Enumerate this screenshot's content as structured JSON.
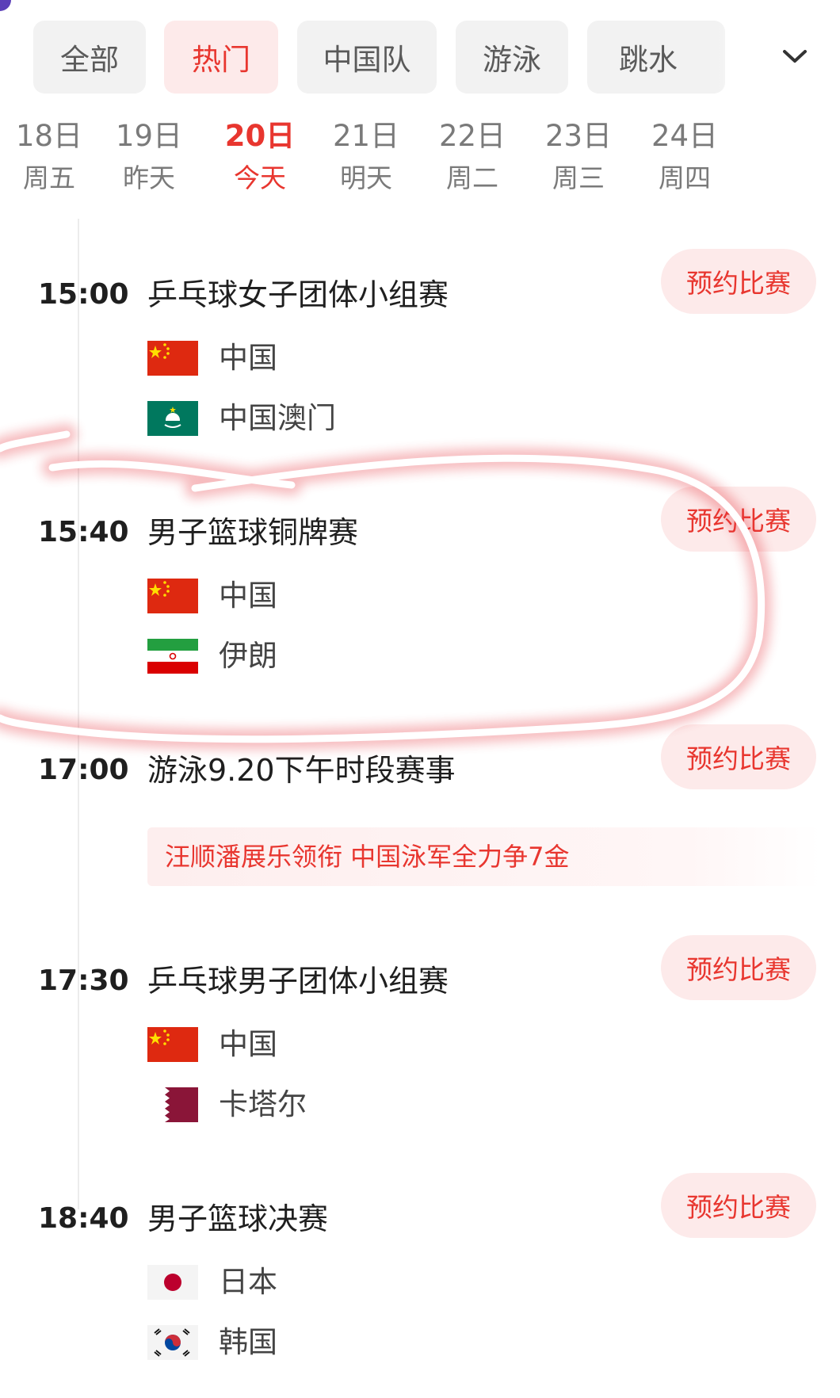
{
  "tabs": [
    {
      "label": "全部",
      "active": false
    },
    {
      "label": "热门",
      "active": true
    },
    {
      "label": "中国队",
      "active": false
    },
    {
      "label": "游泳",
      "active": false
    },
    {
      "label": "跳水",
      "active": false
    }
  ],
  "tabs_more_icon": "chevron-down-icon",
  "dates": [
    {
      "day": "18日",
      "sub": "周五",
      "active": false
    },
    {
      "day": "19日",
      "sub": "昨天",
      "active": false
    },
    {
      "day": "20日",
      "sub": "今天",
      "active": true
    },
    {
      "day": "21日",
      "sub": "明天",
      "active": false
    },
    {
      "day": "22日",
      "sub": "周二",
      "active": false
    },
    {
      "day": "23日",
      "sub": "周三",
      "active": false
    },
    {
      "day": "24日",
      "sub": "周四",
      "active": false
    }
  ],
  "reserve_label": "预约比赛",
  "events": [
    {
      "time": "15:00",
      "title": "乒乓球女子团体小组赛",
      "teams": [
        {
          "name": "中国",
          "flag": "china-flag"
        },
        {
          "name": "中国澳门",
          "flag": "macau-flag"
        }
      ]
    },
    {
      "time": "15:40",
      "title": "男子篮球铜牌赛",
      "teams": [
        {
          "name": "中国",
          "flag": "china-flag"
        },
        {
          "name": "伊朗",
          "flag": "iran-flag"
        }
      ]
    },
    {
      "time": "17:00",
      "title": "游泳9.20下午时段赛事",
      "news": "汪顺潘展乐领衔 中国泳军全力争7金"
    },
    {
      "time": "17:30",
      "title": "乒乓球男子团体小组赛",
      "teams": [
        {
          "name": "中国",
          "flag": "china-flag"
        },
        {
          "name": "卡塔尔",
          "flag": "qatar-flag"
        }
      ]
    },
    {
      "time": "18:40",
      "title": "男子篮球决赛",
      "teams": [
        {
          "name": "日本",
          "flag": "japan-flag"
        },
        {
          "name": "韩国",
          "flag": "korea-flag"
        }
      ]
    }
  ],
  "colors": {
    "accent": "#e8362f",
    "accent_bg": "#fdeaea",
    "tab_bg": "#f2f2f2",
    "annotation": "#e5333a"
  }
}
